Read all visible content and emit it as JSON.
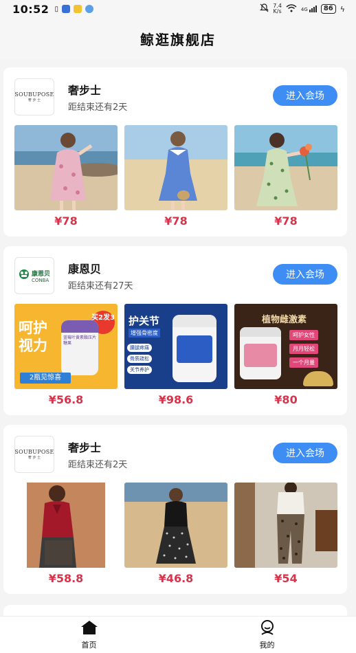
{
  "status_bar": {
    "time": "10:52",
    "net_speed_value": "7.4",
    "net_speed_unit": "K/s",
    "network": "4G",
    "battery": "86"
  },
  "header": {
    "title": "鲸逛旗舰店"
  },
  "cards": [
    {
      "shop_name": "奢步士",
      "logo_text": "SOUBUPOSE",
      "logo_sub": "奢 步 士",
      "countdown": "距结束还有2天",
      "enter_label": "进入会场",
      "products": [
        {
          "price": "¥78",
          "image": "dress-beach-floral"
        },
        {
          "price": "¥78",
          "image": "dress-blue-field"
        },
        {
          "price": "¥78",
          "image": "dress-green-floral"
        }
      ]
    },
    {
      "shop_name": "康恩贝",
      "logo_text": "康恩贝",
      "logo_sub": "CONBA",
      "countdown": "距结束还有27天",
      "enter_label": "进入会场",
      "products": [
        {
          "price": "¥56.8",
          "image": "eye-care-supplement",
          "texts": {
            "title": "呵护视力",
            "badge": "买2发3",
            "bottom": "2瓶见惊喜",
            "bottle": "蓝莓叶黄素酯压片糖果"
          }
        },
        {
          "price": "¥98.6",
          "image": "joint-care-supplement",
          "texts": {
            "title": "护关节",
            "subtitle": "增强骨密度",
            "bullets": [
              "腰腿疼痛",
              "骨质疏松",
              "关节养护"
            ]
          }
        },
        {
          "price": "¥80",
          "image": "plant-estrogen-supplement",
          "texts": {
            "title": "植物雌激素",
            "tags": [
              "呵护女性",
              "月月轻松",
              "一个月量"
            ]
          }
        }
      ]
    },
    {
      "shop_name": "奢步士",
      "logo_text": "SOUBUPOSE",
      "logo_sub": "奢 步 士",
      "countdown": "距结束还有2天",
      "enter_label": "进入会场",
      "products": [
        {
          "price": "¥58.8",
          "image": "red-blouse-outfit"
        },
        {
          "price": "¥46.8",
          "image": "black-top-skirt"
        },
        {
          "price": "¥54",
          "image": "leopard-pants"
        }
      ]
    }
  ],
  "tabbar": {
    "items": [
      {
        "label": "首页",
        "icon": "home-icon",
        "active": true
      },
      {
        "label": "我的",
        "icon": "profile-icon",
        "active": false
      }
    ]
  },
  "colors": {
    "accent": "#3d8df5",
    "price": "#d8334a",
    "background": "#f4f4f4"
  }
}
